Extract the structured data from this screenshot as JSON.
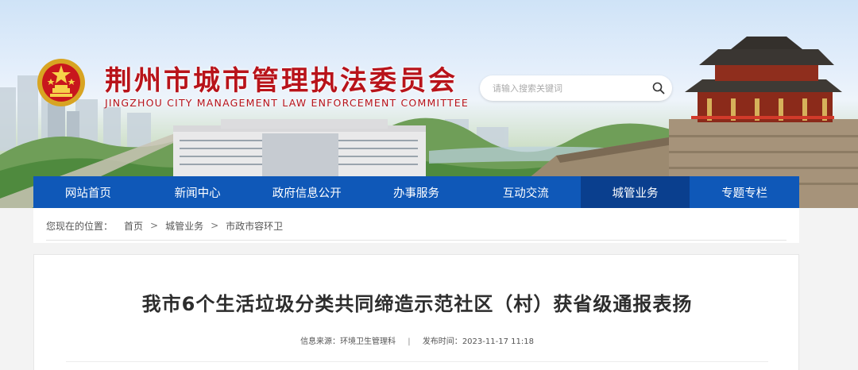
{
  "header": {
    "title_cn": "荆州市城市管理执法委员会",
    "title_en": "JINGZHOU CITY MANAGEMENT LAW ENFORCEMENT COMMITTEE",
    "emblem_icon": "national-emblem-icon",
    "search": {
      "placeholder": "请输入搜索关键词",
      "icon": "search-icon"
    },
    "colors": {
      "title": "#b8131a",
      "nav": "#0f58b8",
      "nav_active": "#0a3f8e"
    }
  },
  "nav": {
    "items": [
      {
        "label": "网站首页"
      },
      {
        "label": "新闻中心"
      },
      {
        "label": "政府信息公开"
      },
      {
        "label": "办事服务"
      },
      {
        "label": "互动交流"
      },
      {
        "label": "城管业务",
        "active": true
      },
      {
        "label": "专题专栏"
      }
    ]
  },
  "breadcrumb": {
    "label": "您现在的位置：",
    "items": [
      "首页",
      "城管业务",
      "市政市容环卫"
    ],
    "separator": ">"
  },
  "article": {
    "title": "我市6个生活垃圾分类共同缔造示范社区（村）获省级通报表扬",
    "source_label": "信息来源：",
    "source": "环境卫生管理科",
    "date_label": "发布时间：",
    "date": "2023-11-17 11:18",
    "divider": "|"
  }
}
